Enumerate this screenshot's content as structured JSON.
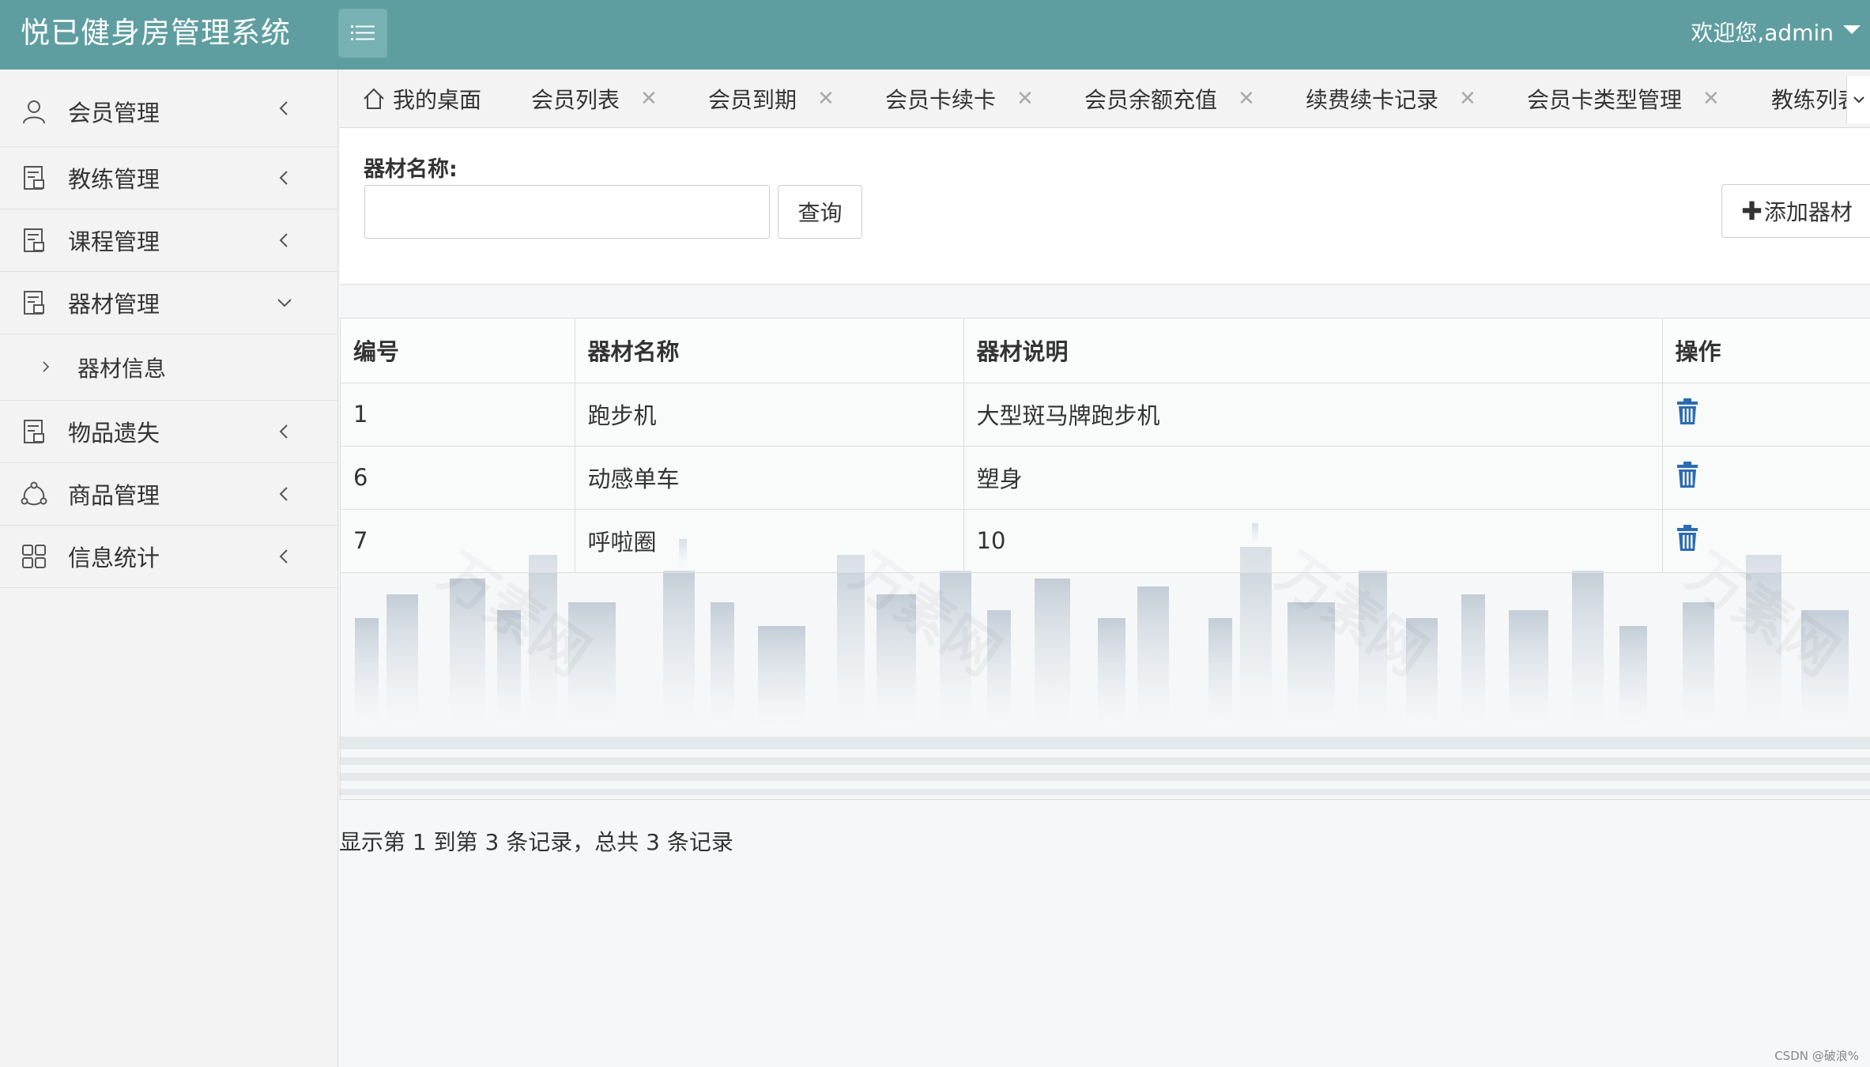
{
  "header": {
    "title": "悦已健身房管理系统",
    "welcome": "欢迎您,admin"
  },
  "sidebar": {
    "items": [
      {
        "label": "会员管理",
        "icon": "user-icon"
      },
      {
        "label": "教练管理",
        "icon": "document-icon"
      },
      {
        "label": "课程管理",
        "icon": "document-icon"
      },
      {
        "label": "器材管理",
        "icon": "document-icon",
        "expanded": true
      },
      {
        "label": "物品遗失",
        "icon": "document-icon"
      },
      {
        "label": "商品管理",
        "icon": "share-icon"
      },
      {
        "label": "信息统计",
        "icon": "grid-icon"
      }
    ],
    "sub_items": [
      {
        "label": "器材信息"
      }
    ]
  },
  "tabs": [
    {
      "label": "我的桌面"
    },
    {
      "label": "会员列表"
    },
    {
      "label": "会员到期"
    },
    {
      "label": "会员卡续卡"
    },
    {
      "label": "会员余额充值"
    },
    {
      "label": "续费续卡记录"
    },
    {
      "label": "会员卡类型管理"
    },
    {
      "label": "教练列表"
    }
  ],
  "search": {
    "label": "器材名称:",
    "value": "",
    "query_button": "查询",
    "add_button": "添加器材"
  },
  "table": {
    "headers": [
      "编号",
      "器材名称",
      "器材说明",
      "操作"
    ],
    "rows": [
      {
        "id": "1",
        "name": "跑步机",
        "desc": "大型斑马牌跑步机"
      },
      {
        "id": "6",
        "name": "动感单车",
        "desc": "塑身"
      },
      {
        "id": "7",
        "name": "呼啦圈",
        "desc": "10"
      }
    ]
  },
  "pager": {
    "summary": "显示第 1 到第 3 条记录，总共 3 条记录"
  },
  "watermark": "万素网",
  "footer": "CSDN @破浪%",
  "colors": {
    "header_bg": "#5f9ea0",
    "accent_icon": "#2b6cb0"
  }
}
